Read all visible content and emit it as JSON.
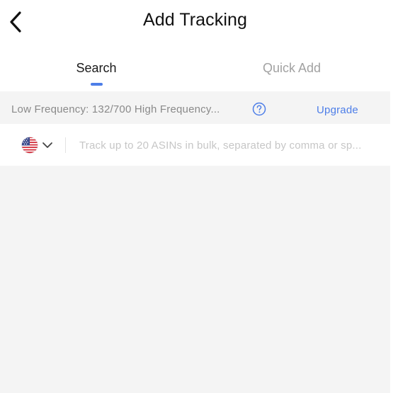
{
  "header": {
    "title": "Add Tracking",
    "back_icon": "chevron-left-icon"
  },
  "tabs": [
    {
      "label": "Search",
      "active": true
    },
    {
      "label": "Quick Add",
      "active": false
    }
  ],
  "frequency_bar": {
    "text": "Low Frequency: 132/700 High Frequency...",
    "help_icon": "question-circle-icon",
    "upgrade_label": "Upgrade"
  },
  "search": {
    "country_icon": "us-flag-icon",
    "dropdown_icon": "chevron-down-icon",
    "placeholder": "Track up to 20 ASINs in bulk, separated by comma or sp...",
    "value": ""
  },
  "colors": {
    "accent": "#4d7ee8",
    "panel_bg": "#f4f4f4",
    "text_primary": "#111111",
    "text_muted": "#8a8a8a",
    "placeholder": "#c6c6c6"
  }
}
